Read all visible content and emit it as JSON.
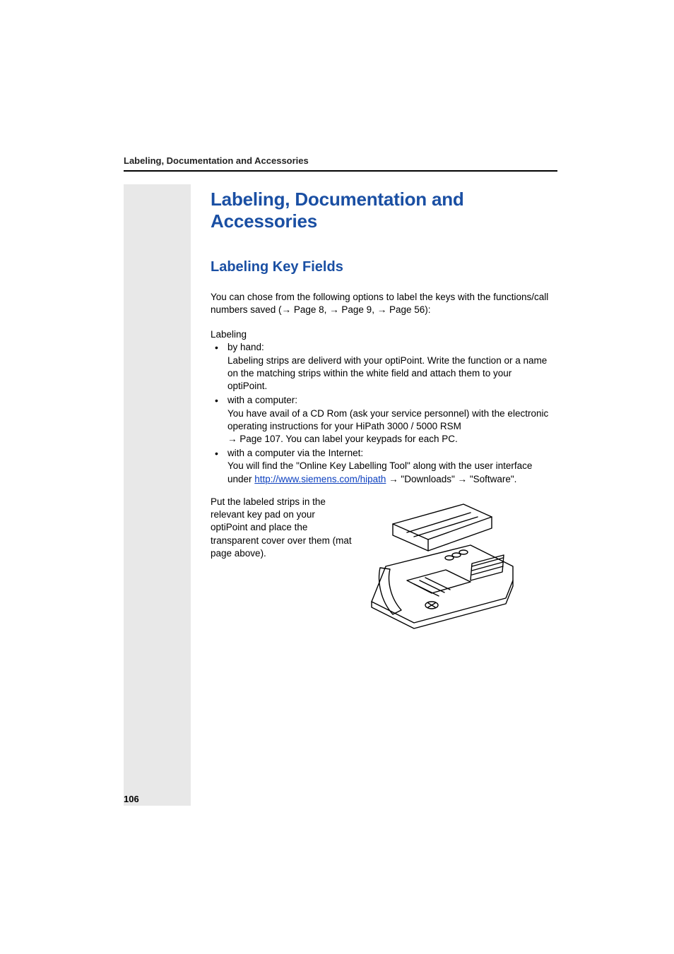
{
  "header": {
    "running_title": "Labeling, Documentation and Accessories"
  },
  "title": "Labeling, Documentation and Accessories",
  "subtitle": "Labeling Key Fields",
  "intro": {
    "pre": "You can chose from the following options to label the keys with the functions/call numbers saved (",
    "ref1": "Page 8",
    "sep1": ", ",
    "ref2": "Page 9",
    "sep2": ", ",
    "ref3": "Page 56",
    "post": "):"
  },
  "labeling_label": "Labeling",
  "bullets": [
    {
      "head": "by hand:",
      "body": "Labeling strips are deliverd with your optiPoint. Write the function or a name on the matching strips within the white field and attach them to your optiPoint."
    },
    {
      "head": "with a computer:",
      "body_pre": "You have avail of a CD Rom (ask your service personnel) with the electronic operating instructions for your HiPath 3000 / 5000 RSM ",
      "ref": "Page 107",
      "body_post": ". You can label your keypads for each PC."
    },
    {
      "head": "with a computer via the Internet:",
      "body_pre": "You will find the \"Online Key Labelling Tool\" along with the user interface under ",
      "url": "http://www.siemens.com/hipath",
      "body_mid": " ",
      "dl": "\"Downloads\"",
      "body_mid2": " ",
      "sw": "\"Software\"",
      "body_post": "."
    }
  ],
  "closing": "Put the labeled strips in the relevant key pad on your optiPoint and place the transparent cover over them (mat page above).",
  "arrow_glyph": "→",
  "page_number": "106"
}
